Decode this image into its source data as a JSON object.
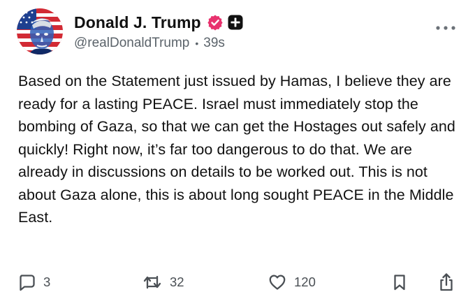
{
  "post": {
    "author": {
      "display_name": "Donald J. Trump",
      "handle": "@realDonaldTrump",
      "timestamp": "39s",
      "separator": "•"
    },
    "body": "Based on the Statement just issued by Hamas, I believe they are ready for a lasting PEACE. Israel must immediately stop the bombing of Gaza, so that we can get the Hostages out safely and quickly! Right now, it’s far too dangerous to do that. We are already in discussions on details to be worked out. This is not about Gaza alone, this is about long sought PEACE in the Middle East.",
    "actions": {
      "replies": "3",
      "reposts": "32",
      "likes": "120"
    }
  },
  "icons": {
    "avatar": "profile-photo",
    "verified": "verified-badge-icon",
    "plus": "plus-badge-icon",
    "more": "more-horizontal-icon",
    "reply": "comment-bubble-icon",
    "repost": "repost-arrows-icon",
    "like": "heart-icon",
    "bookmark": "bookmark-icon",
    "share": "share-upload-icon"
  },
  "colors": {
    "verified_badge": "#e8326e",
    "plus_badge": "#111111",
    "text_primary": "#111111",
    "text_secondary": "#5b636a"
  }
}
